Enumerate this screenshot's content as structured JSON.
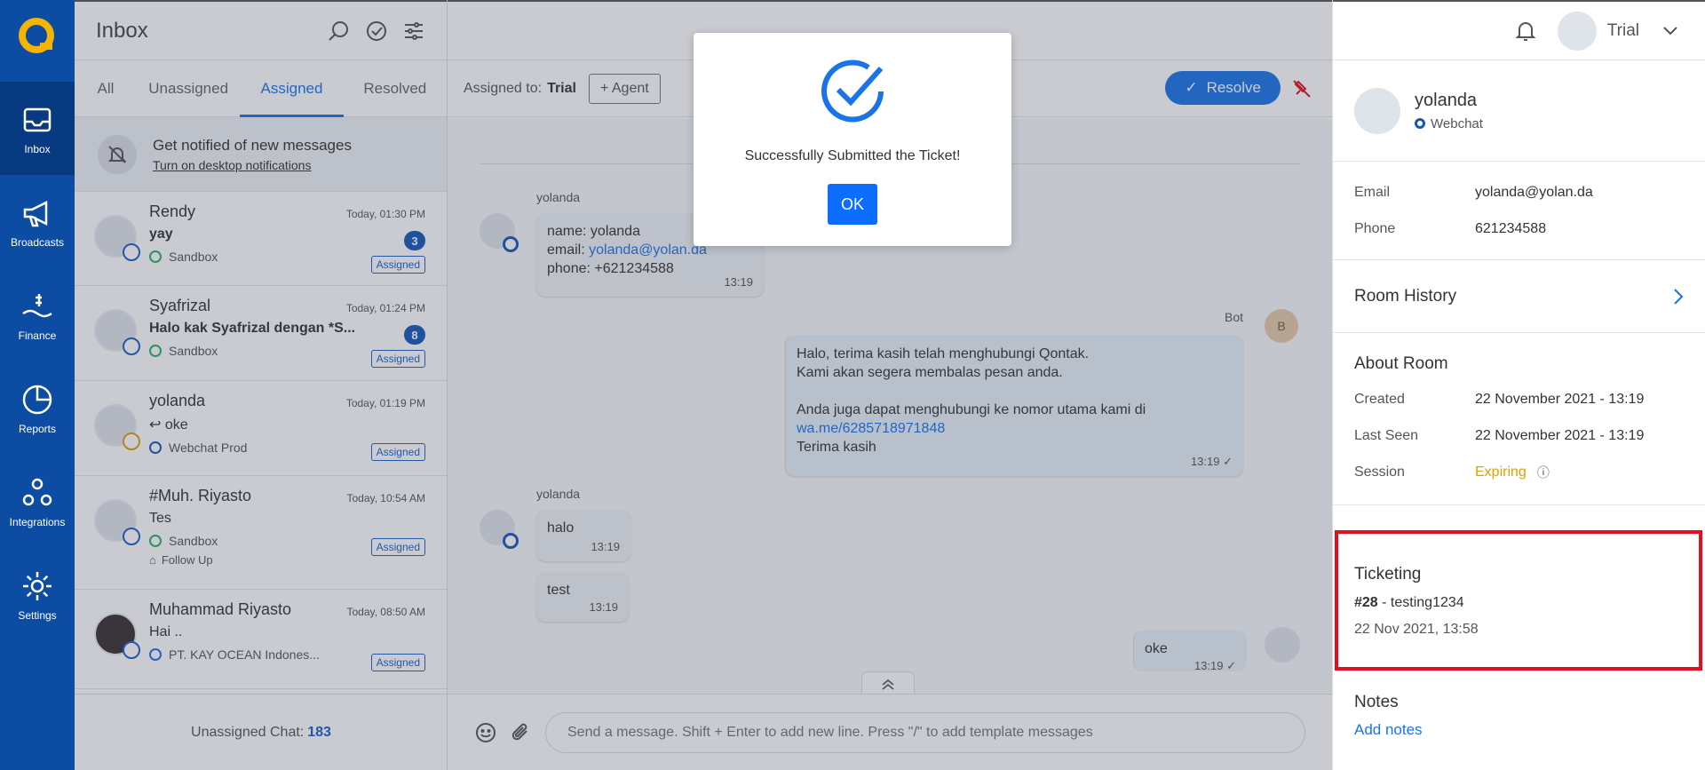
{
  "sidebar": {
    "items": [
      {
        "label": "Inbox",
        "icon": "inbox-icon",
        "active": true
      },
      {
        "label": "Broadcasts",
        "icon": "megaphone-icon"
      },
      {
        "label": "Finance",
        "icon": "finance-icon"
      },
      {
        "label": "Reports",
        "icon": "pie-chart-icon"
      },
      {
        "label": "Integrations",
        "icon": "integrations-icon"
      },
      {
        "label": "Settings",
        "icon": "gear-icon"
      }
    ]
  },
  "inbox": {
    "title": "Inbox",
    "tabs": [
      "All",
      "Unassigned",
      "Assigned",
      "Resolved"
    ],
    "active_tab": "Assigned",
    "notify": {
      "title": "Get notified of new messages",
      "link": "Turn on desktop notifications"
    },
    "conversations": [
      {
        "name": "Rendy",
        "time": "Today, 01:30 PM",
        "message": "yay",
        "source": "Sandbox",
        "count": "3",
        "status": "Assigned"
      },
      {
        "name": "Syafrizal",
        "time": "Today, 01:24 PM",
        "message": "Halo kak Syafrizal dengan *S...",
        "source": "Sandbox",
        "count": "8",
        "status": "Assigned"
      },
      {
        "name": "yolanda",
        "time": "Today, 01:19 PM",
        "message": "oke",
        "source": "Webchat Prod",
        "status": "Assigned"
      },
      {
        "name": "#Muh. Riyasto",
        "time": "Today, 10:54 AM",
        "message": "Tes",
        "source": "Sandbox",
        "tag": "Follow Up",
        "status": "Assigned"
      },
      {
        "name": "Muhammad Riyasto",
        "time": "Today, 08:50 AM",
        "message": "Hai ..",
        "source": "PT. KAY OCEAN Indones...",
        "status": "Assigned"
      }
    ],
    "footer_label": "Unassigned Chat:",
    "footer_count": "183"
  },
  "chat": {
    "assigned_label": "Assigned to:",
    "assigned_to": "Trial",
    "agent_button": "+ Agent",
    "resolve_button": "Resolve",
    "messages": {
      "sender1": "yolanda",
      "m1_line1": "name: yolanda",
      "m1_line2_prefix": "email: ",
      "m1_email": "yolanda@yolan.da",
      "m1_line3": "phone: +621234588",
      "m1_time": "13:19",
      "bot_label": "Bot",
      "bot_initial": "B",
      "m2_line1": "Halo, terima kasih telah menghubungi Qontak.",
      "m2_line2": "Kami akan segera membalas pesan anda.",
      "m2_line3": "Anda juga dapat menghubungi ke nomor utama kami di",
      "m2_link": "wa.me/6285718971848",
      "m2_line4": "Terima kasih",
      "m2_time": "13:19",
      "sender2": "yolanda",
      "m3": "halo",
      "m3_time": "13:19",
      "m4": "test",
      "m4_time": "13:19",
      "m5": "oke",
      "m5_time": "13:19"
    },
    "composer_placeholder": "Send a message. Shift + Enter to add new line. Press \"/\" to add template messages"
  },
  "header": {
    "user_name": "Trial"
  },
  "contact": {
    "name": "yolanda",
    "source": "Webchat",
    "email_label": "Email",
    "email": "yolanda@yolan.da",
    "phone_label": "Phone",
    "phone": "621234588",
    "room_history": "Room History",
    "about_title": "About Room",
    "created_label": "Created",
    "created": "22 November 2021 - 13:19",
    "last_seen_label": "Last Seen",
    "last_seen": "22 November 2021 - 13:19",
    "session_label": "Session",
    "session": "Expiring",
    "ticketing_title": "Ticketing",
    "ticket_id": "#28",
    "ticket_name": " - testing1234",
    "ticket_date": "22 Nov 2021, 13:58",
    "notes_title": "Notes",
    "add_notes": "Add notes"
  },
  "modal": {
    "message": "Successfully Submitted the Ticket!",
    "ok": "OK"
  },
  "colors": {
    "sidebar": "#0d4ca3",
    "accent": "#1a73e8",
    "highlight": "#e01020",
    "warning": "#e0a000"
  }
}
